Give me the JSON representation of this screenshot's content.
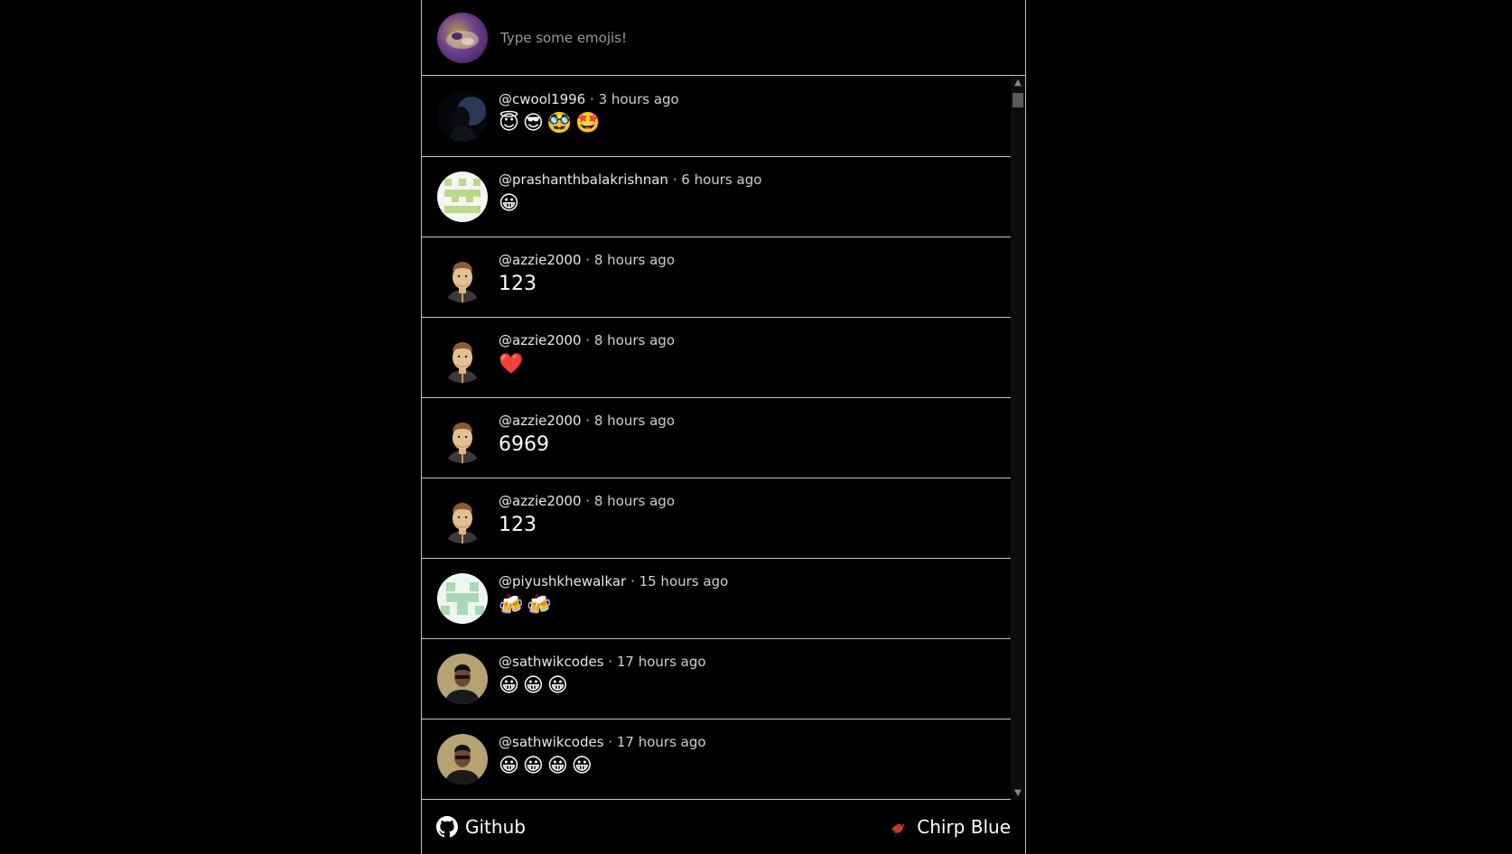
{
  "composer": {
    "placeholder": "Type some emojis!",
    "avatar_icon": "user-avatar-icon"
  },
  "posts": [
    {
      "username": "@cwool1996",
      "time": "3 hours ago",
      "content": "😇😎🥸🤩",
      "avatar": "dark-silhouette"
    },
    {
      "username": "@prashanthbalakrishnan",
      "time": "6 hours ago",
      "content": "😀",
      "avatar": "green-pixel"
    },
    {
      "username": "@azzie2000",
      "time": "8 hours ago",
      "content": "123",
      "avatar": "memoji"
    },
    {
      "username": "@azzie2000",
      "time": "8 hours ago",
      "content": "❤️",
      "avatar": "memoji"
    },
    {
      "username": "@azzie2000",
      "time": "8 hours ago",
      "content": "6969",
      "avatar": "memoji"
    },
    {
      "username": "@azzie2000",
      "time": "8 hours ago",
      "content": "123",
      "avatar": "memoji"
    },
    {
      "username": "@piyushkhewalkar",
      "time": "15 hours ago",
      "content": "🍻🍻",
      "avatar": "mint-pixel"
    },
    {
      "username": "@sathwikcodes",
      "time": "17 hours ago",
      "content": "😀😀😀",
      "avatar": "photo"
    },
    {
      "username": "@sathwikcodes",
      "time": "17 hours ago",
      "content": "😀😀😀😀",
      "avatar": "photo"
    }
  ],
  "separator": "·",
  "footer": {
    "github_label": "Github",
    "github_icon": "github-icon",
    "chirp_label": "Chirp Blue",
    "chirp_icon": "bird-icon"
  },
  "colors": {
    "background": "#000000",
    "border": "#c7c7c7",
    "meta_text": "#cfcfcf"
  }
}
